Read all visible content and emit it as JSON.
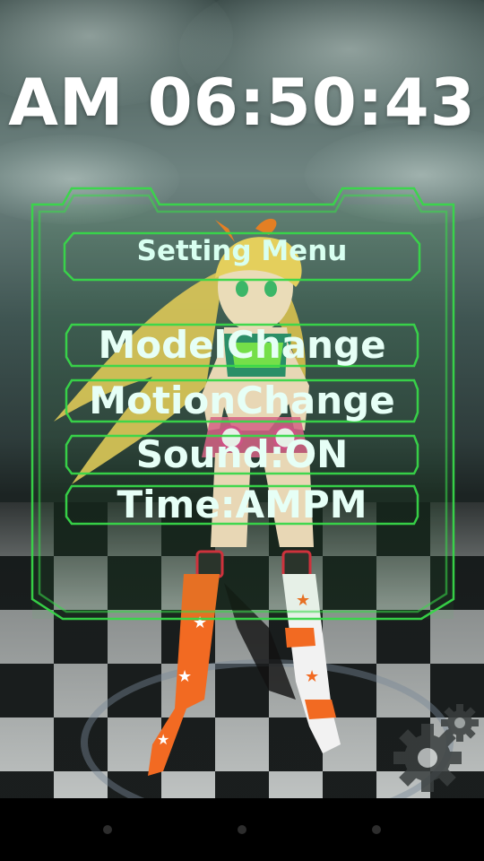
{
  "clock": {
    "time_text": "AM 06:50:43"
  },
  "menu": {
    "title": "Setting Menu",
    "items": [
      {
        "label": "ModelChange"
      },
      {
        "label": "MotionChange"
      },
      {
        "label": "Sound:ON"
      },
      {
        "label": "Time:AMPM"
      }
    ]
  },
  "settings_button": {
    "icon": "gear-icon"
  },
  "colors": {
    "panel_green": "#39d84a",
    "text_mint": "#e6fff6",
    "clock_white": "#ffffff"
  },
  "navbar": {
    "buttons": [
      "back-icon",
      "home-icon",
      "recent-apps-icon"
    ]
  }
}
